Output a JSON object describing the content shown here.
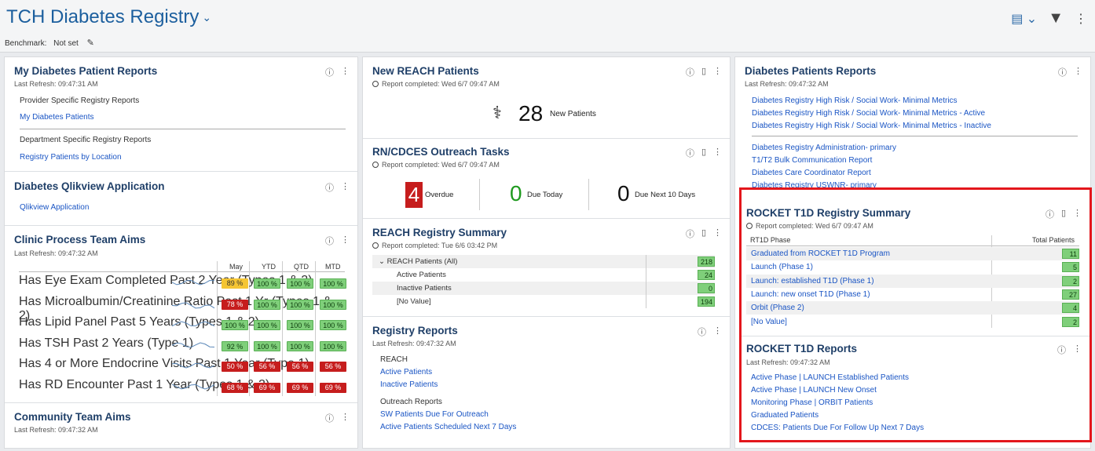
{
  "app": {
    "title": "TCH Diabetes Registry",
    "benchmark_label": "Benchmark:",
    "benchmark_value": "Not set"
  },
  "left": {
    "my_reports": {
      "title": "My Diabetes Patient Reports",
      "refresh": "Last Refresh: 09:47:31 AM",
      "section1": "Provider Specific Registry Reports",
      "link1": "My Diabetes Patients",
      "section2": "Department Specific Registry Reports",
      "link2": "Registry Patients by Location"
    },
    "qlik": {
      "title": "Diabetes Qlikview Application",
      "link": "Qlikview Application"
    },
    "aims": {
      "title": "Clinic Process Team Aims",
      "refresh": "Last Refresh: 09:47:32 AM",
      "headers": [
        "May",
        "YTD",
        "QTD",
        "MTD"
      ],
      "rows": [
        {
          "label": "Has Eye Exam Completed Past 2 Year (Types 1 & 2)",
          "values": [
            "89 %",
            "100 %",
            "100 %",
            "100 %"
          ]
        },
        {
          "label": "Has Microalbumin/Creatinine Ratio Past 1 Yr (Types 1 & 2)",
          "values": [
            "78 %",
            "100 %",
            "100 %",
            "100 %"
          ]
        },
        {
          "label": "Has Lipid Panel Past 5 Years (Types 1 & 2)",
          "values": [
            "100 %",
            "100 %",
            "100 %",
            "100 %"
          ]
        },
        {
          "label": "Has TSH Past 2 Years (Type 1)",
          "values": [
            "92 %",
            "100 %",
            "100 %",
            "100 %"
          ]
        },
        {
          "label": "Has 4 or More Endocrine Visits Past 1 Year (Type 1)",
          "values": [
            "50 %",
            "56 %",
            "56 %",
            "56 %"
          ]
        },
        {
          "label": "Has RD Encounter Past 1 Year (Types 1 & 2)",
          "values": [
            "68 %",
            "69 %",
            "69 %",
            "69 %"
          ]
        }
      ]
    },
    "community": {
      "title": "Community Team Aims",
      "refresh": "Last Refresh: 09:47:32 AM"
    }
  },
  "middle": {
    "new_reach": {
      "title": "New REACH Patients",
      "completed": "Report completed: Wed 6/7 09:47 AM",
      "count": "28",
      "count_label": "New Patients"
    },
    "outreach": {
      "title": "RN/CDCES Outreach Tasks",
      "completed": "Report completed: Wed 6/7 09:47 AM",
      "overdue": "4",
      "overdue_label": "Overdue",
      "today": "0",
      "today_label": "Due Today",
      "next10": "0",
      "next10_label": "Due Next 10 Days"
    },
    "reach_summary": {
      "title": "REACH Registry Summary",
      "completed": "Report completed: Tue 6/6 03:42 PM",
      "rows": [
        {
          "label": "REACH Patients (All)",
          "value": "218"
        },
        {
          "label": "Active Patients",
          "value": "24"
        },
        {
          "label": "Inactive Patients",
          "value": "0"
        },
        {
          "label": "[No Value]",
          "value": "194"
        }
      ]
    },
    "registry_reports": {
      "title": "Registry Reports",
      "refresh": "Last Refresh: 09:47:32 AM",
      "section1": "REACH",
      "link1": "Active Patients",
      "link2": "Inactive Patients",
      "section2": "Outreach Reports",
      "link3": "SW Patients Due For Outreach",
      "link4": "Active Patients Scheduled Next 7 Days"
    }
  },
  "right": {
    "dp_reports": {
      "title": "Diabetes Patients Reports",
      "refresh": "Last Refresh: 09:47:32 AM",
      "links": [
        "Diabetes Registry High Risk / Social Work- Minimal Metrics",
        "Diabetes Registry High Risk / Social Work- Minimal Metrics - Active",
        "Diabetes Registry High Risk / Social Work- Minimal Metrics - Inactive"
      ],
      "links2": [
        "Diabetes Registry Administration- primary",
        "T1/T2 Bulk Communication Report",
        "Diabetes Care Coordinator Report",
        "Diabetes Registry USWNR- primary"
      ]
    },
    "rocket_summary": {
      "title": "ROCKET T1D Registry Summary",
      "completed": "Report completed: Wed 6/7 09:47 AM",
      "col1": "RT1D Phase",
      "col2": "Total Patients",
      "rows": [
        {
          "label": "Graduated from ROCKET T1D Program",
          "value": "11"
        },
        {
          "label": "Launch (Phase 1)",
          "value": "5"
        },
        {
          "label": "Launch: established T1D (Phase 1)",
          "value": "2"
        },
        {
          "label": "Launch: new onset T1D (Phase 1)",
          "value": "27"
        },
        {
          "label": "Orbit (Phase 2)",
          "value": "4"
        },
        {
          "label": "[No Value]",
          "value": "2"
        }
      ]
    },
    "rocket_reports": {
      "title": "ROCKET T1D Reports",
      "refresh": "Last Refresh: 09:47:32 AM",
      "links": [
        "Active Phase | LAUNCH Established Patients",
        "Active Phase | LAUNCH New Onset",
        "Monitoring Phase | ORBIT Patients",
        "Graduated Patients",
        "CDCES: Patients Due For Follow Up Next 7 Days"
      ]
    }
  },
  "colors": {
    "accent": "#1c5f9e",
    "link": "#1a55c4",
    "good": "#7fcf7a",
    "bad": "#c61d1d",
    "warn": "#f5c533",
    "highlight": "#e3161c"
  }
}
